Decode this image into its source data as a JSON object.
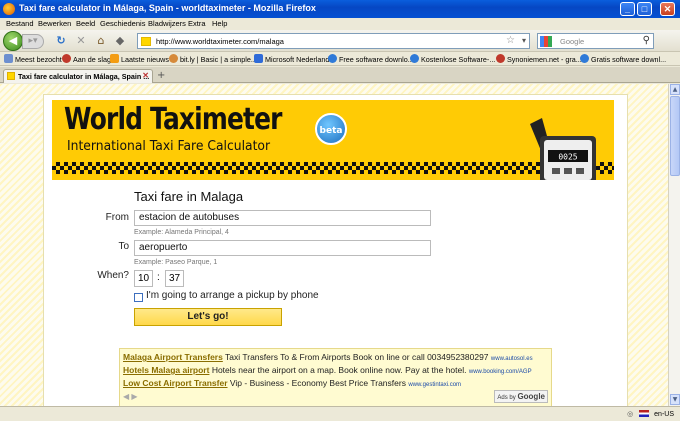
{
  "window": {
    "title": "Taxi fare calculator in Málaga, Spain - worldtaximeter - Mozilla Firefox"
  },
  "menu": [
    "Bestand",
    "Bewerken",
    "Beeld",
    "Geschiedenis",
    "Bladwijzers",
    "Extra",
    "Help"
  ],
  "nav": {
    "url": "http://www.worldtaximeter.com/malaga",
    "search_placeholder": "Google"
  },
  "bookmarks": [
    "Meest bezocht",
    "Aan de slag",
    "Laatste nieuws",
    "bit.ly | Basic | a simple...",
    "Microsoft Nederland",
    "Free software downlo...",
    "Kostenlose Software-...",
    "Synoniemen.net - gra...",
    "Gratis software downl..."
  ],
  "tab": {
    "label": "Taxi fare calculator in Málaga, Spain ..."
  },
  "banner": {
    "title": "World Taximeter",
    "subtitle": "International Taxi Fare Calculator",
    "badge": "beta",
    "meter_digits": "0025"
  },
  "form": {
    "title": "Taxi fare in Malaga",
    "from_label": "From",
    "from_value": "estacion de autobuses",
    "from_example": "Example: Alameda Principal, 4",
    "to_label": "To",
    "to_value": "aeropuerto",
    "to_example": "Example: Paseo Parque, 1",
    "when_label": "When?",
    "hour": "10",
    "minute": "37",
    "time_sep": ":",
    "pickup_label": "I'm going to arrange a pickup by phone",
    "submit_label": "Let's go!"
  },
  "ads": [
    {
      "title": "Malaga Airport Transfers",
      "text": "Taxi Transfers To & From Airports Book on line or call 0034952380297",
      "url": "www.autosol.es"
    },
    {
      "title": "Hotels Malaga airport",
      "text": "Hotels near the airport on a map. Book online now. Pay at the hotel.",
      "url": "www.booking.com/AGP"
    },
    {
      "title": "Low Cost Airport Transfer",
      "text": "Vip - Business - Economy Best Price Transfers",
      "url": "www.gestintaxi.com"
    }
  ],
  "ads_by": "Ads by",
  "ads_brand": "Google",
  "status": {
    "locale": "en-US"
  }
}
